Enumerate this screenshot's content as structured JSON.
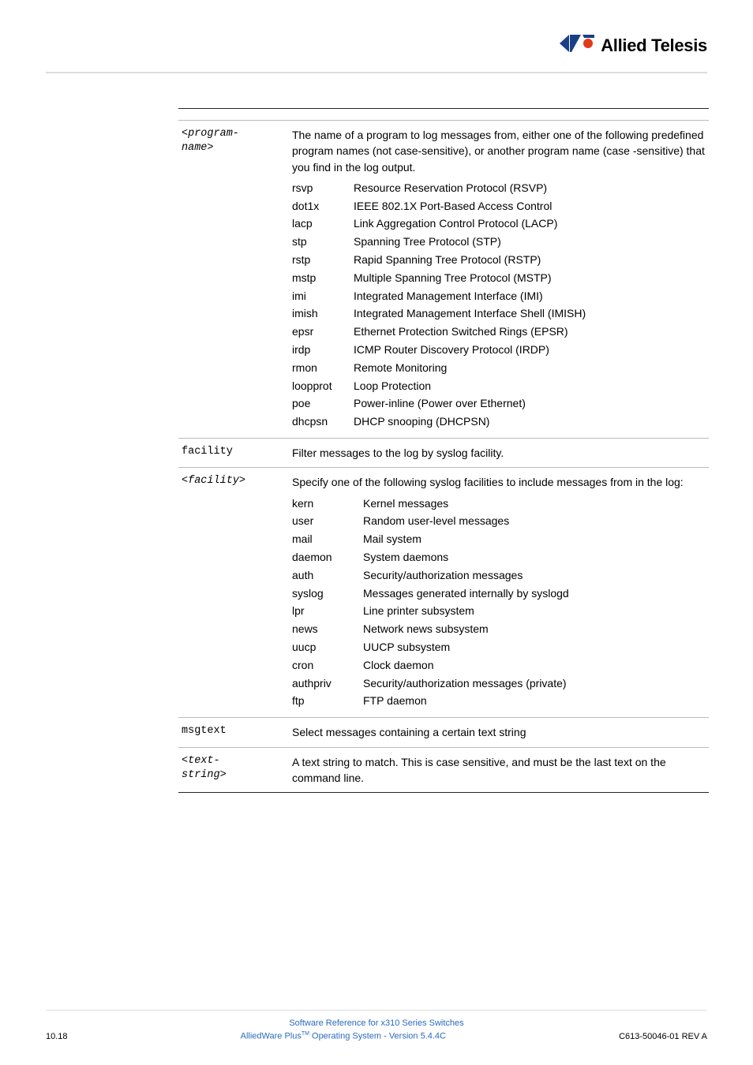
{
  "logo": {
    "brand": "Allied Telesis"
  },
  "params": {
    "program_name": {
      "label": "<program-\nname>",
      "intro": "The name of a program to log messages from, either one of the following predefined program names (not case-sensitive), or another program name (case -sensitive) that you find in the log output.",
      "items": [
        {
          "k": "rsvp",
          "v": "Resource Reservation Protocol (RSVP)"
        },
        {
          "k": "dot1x",
          "v": "IEEE 802.1X Port-Based Access Control"
        },
        {
          "k": "lacp",
          "v": "Link Aggregation Control Protocol (LACP)"
        },
        {
          "k": "stp",
          "v": "Spanning Tree Protocol (STP)"
        },
        {
          "k": "rstp",
          "v": "Rapid Spanning Tree Protocol (RSTP)"
        },
        {
          "k": "mstp",
          "v": "Multiple Spanning Tree Protocol (MSTP)"
        },
        {
          "k": "imi",
          "v": "Integrated Management Interface (IMI)"
        },
        {
          "k": "imish",
          "v": "Integrated Management Interface Shell (IMISH)"
        },
        {
          "k": "epsr",
          "v": "Ethernet Protection Switched Rings (EPSR)"
        },
        {
          "k": "irdp",
          "v": "ICMP Router Discovery Protocol (IRDP)"
        },
        {
          "k": "rmon",
          "v": "Remote Monitoring"
        },
        {
          "k": "loopprot",
          "v": "Loop Protection"
        },
        {
          "k": "poe",
          "v": "Power-inline (Power over Ethernet)"
        },
        {
          "k": "dhcpsn",
          "v": "DHCP snooping (DHCPSN)"
        }
      ]
    },
    "facility": {
      "label": "facility",
      "desc": "Filter messages to the log by syslog facility."
    },
    "facility_val": {
      "label": "<facility>",
      "intro": "Specify one of the following syslog facilities to include messages from in the log:",
      "items": [
        {
          "k": "kern",
          "v": "Kernel messages"
        },
        {
          "k": "user",
          "v": "Random user-level messages"
        },
        {
          "k": "mail",
          "v": "Mail system"
        },
        {
          "k": "daemon",
          "v": "System daemons"
        },
        {
          "k": "auth",
          "v": "Security/authorization messages"
        },
        {
          "k": "syslog",
          "v": "Messages generated internally by syslogd"
        },
        {
          "k": "lpr",
          "v": "Line printer subsystem"
        },
        {
          "k": "news",
          "v": "Network news subsystem"
        },
        {
          "k": "uucp",
          "v": "UUCP subsystem"
        },
        {
          "k": "cron",
          "v": "Clock daemon"
        },
        {
          "k": "authpriv",
          "v": "Security/authorization messages (private)"
        },
        {
          "k": "ftp",
          "v": "FTP daemon"
        }
      ]
    },
    "msgtext": {
      "label": "msgtext",
      "desc": "Select messages containing a certain text string"
    },
    "text_string": {
      "label": "<text-\nstring>",
      "desc": "A text string to match. This is case sensitive, and must be the last text on the command line."
    }
  },
  "footer": {
    "line1": "Software Reference for x310 Series Switches",
    "page_num": "10.18",
    "prod_prefix": "AlliedWare Plus",
    "prod_tm": "TM",
    "prod_suffix": " Operating System  - Version 5.4.4C",
    "doc_ref": "C613-50046-01 REV A"
  }
}
